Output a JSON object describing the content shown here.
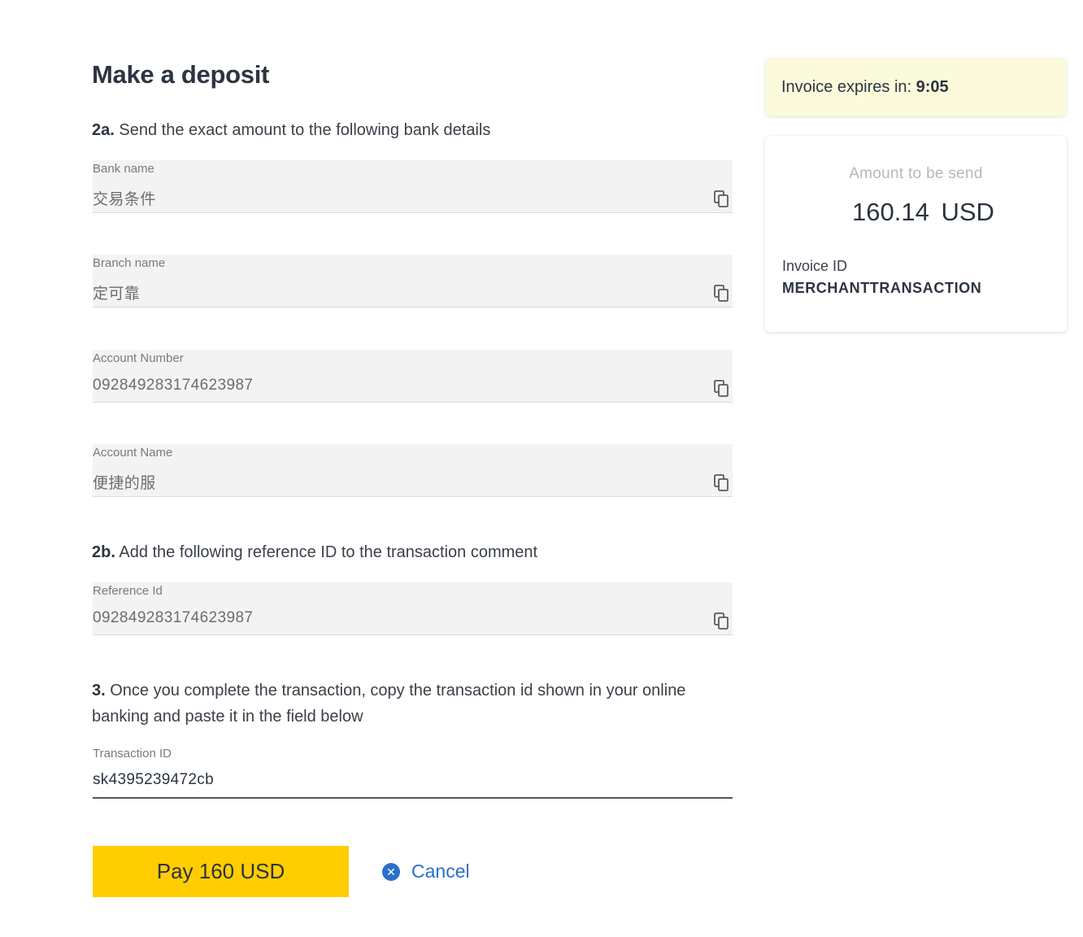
{
  "page": {
    "title": "Make a deposit"
  },
  "step_2a": {
    "num": "2a.",
    "text": "Send the exact amount to the following bank details"
  },
  "bank_fields": [
    {
      "label": "Bank name",
      "value": "交易条件"
    },
    {
      "label": "Branch name",
      "value": "定可靠"
    },
    {
      "label": "Account Number",
      "value": "092849283174623987"
    },
    {
      "label": "Account Name",
      "value": "便捷的服"
    }
  ],
  "step_2b": {
    "num": "2b.",
    "text": "Add the following reference ID to the transaction comment"
  },
  "reference": {
    "label": "Reference Id",
    "value": "092849283174623987"
  },
  "step_3": {
    "num": "3.",
    "text": "Once you complete the transaction, copy the transaction id shown in your online banking and paste it in the field below"
  },
  "transaction": {
    "label": "Transaction ID",
    "value": "sk4395239472cb"
  },
  "actions": {
    "pay_label": "Pay 160 USD",
    "cancel_label": "Cancel"
  },
  "timer": {
    "label": "Invoice expires in:",
    "value": "9:05"
  },
  "summary": {
    "amount_label": "Amount to be send",
    "amount_value": "160.14 USD",
    "invoice_label": "Invoice ID",
    "invoice_value": "MERCHANTTRANSACTION"
  },
  "icons": {
    "copy": "copy-icon",
    "cancel": "close-circle-icon"
  },
  "colors": {
    "accent_yellow": "#ffcd00",
    "link_blue": "#2a6fc9",
    "timer_bg": "#fbfadb"
  }
}
